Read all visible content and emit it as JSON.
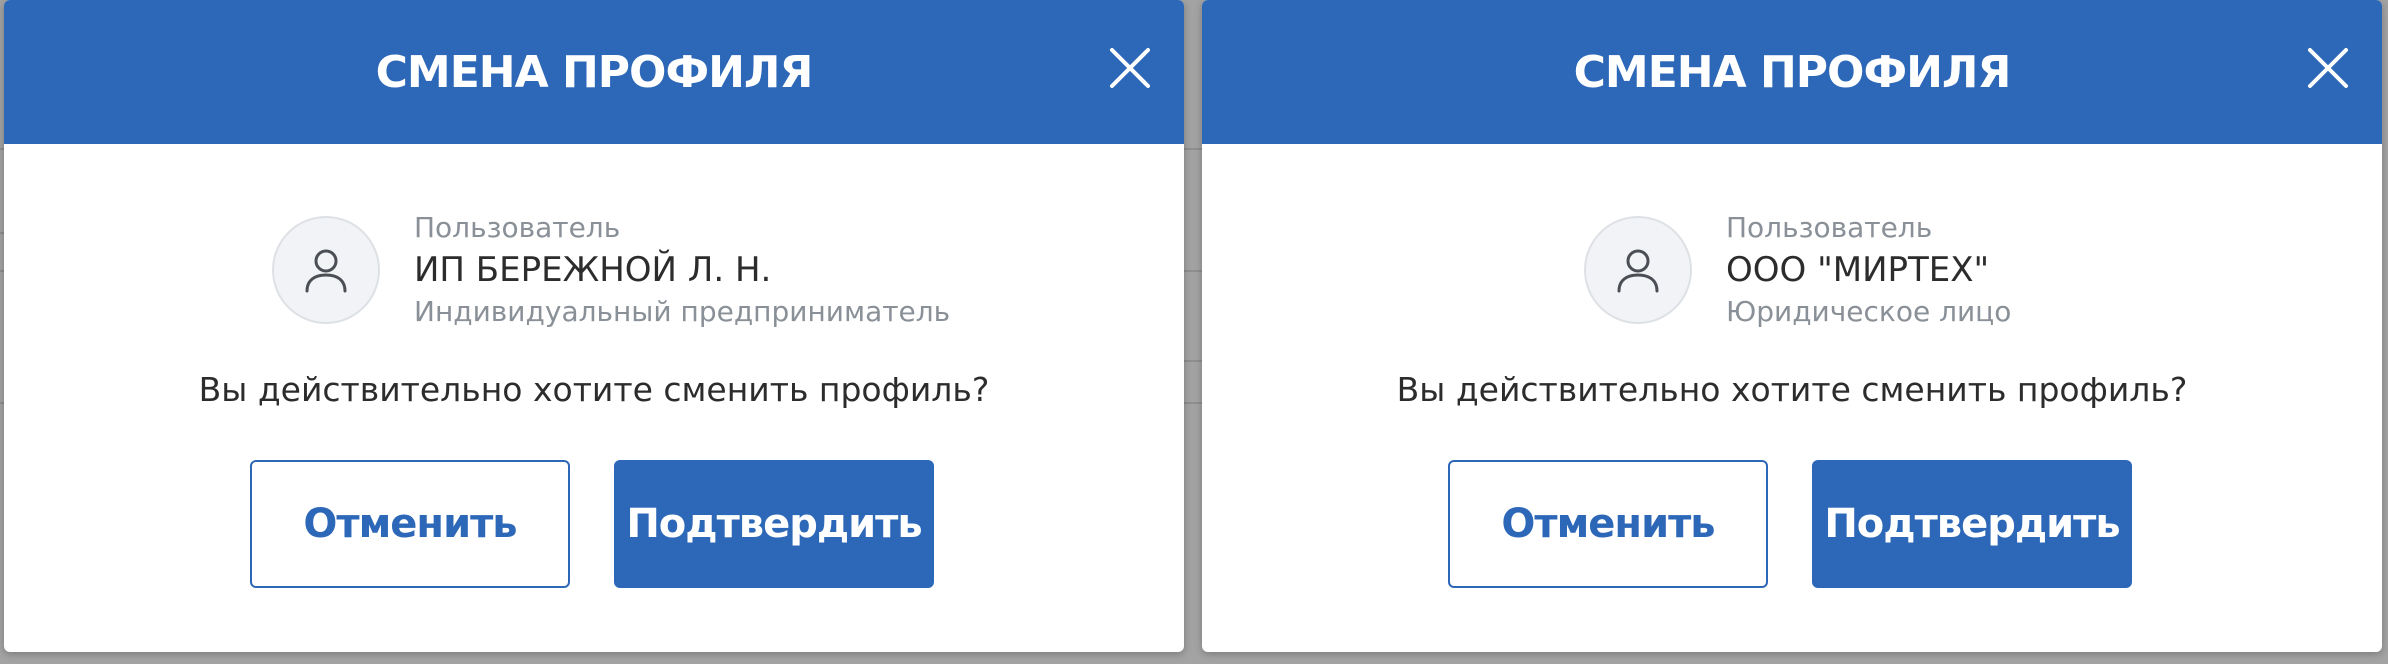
{
  "colors": {
    "accent": "#2d68b8",
    "header_text": "#ffffff",
    "muted_text": "#8a9097",
    "body_text": "#2c2c2c",
    "avatar_bg": "#f1f3f6"
  },
  "modals": [
    {
      "title": "СМЕНА ПРОФИЛЯ",
      "close_icon": "close-icon",
      "profile": {
        "avatar_icon": "user-icon",
        "label": "Пользователь",
        "name": "ИП БЕРЕЖНОЙ Л. Н.",
        "type": "Индивидуальный предприниматель"
      },
      "question": "Вы действительно хотите сменить профиль?",
      "cancel_label": "Отменить",
      "confirm_label": "Подтвердить"
    },
    {
      "title": "СМЕНА ПРОФИЛЯ",
      "close_icon": "close-icon",
      "profile": {
        "avatar_icon": "user-icon",
        "label": "Пользователь",
        "name": "ООО \"МИРТЕХ\"",
        "type": "Юридическое лицо"
      },
      "question": "Вы действительно хотите сменить профиль?",
      "cancel_label": "Отменить",
      "confirm_label": "Подтвердить"
    }
  ]
}
